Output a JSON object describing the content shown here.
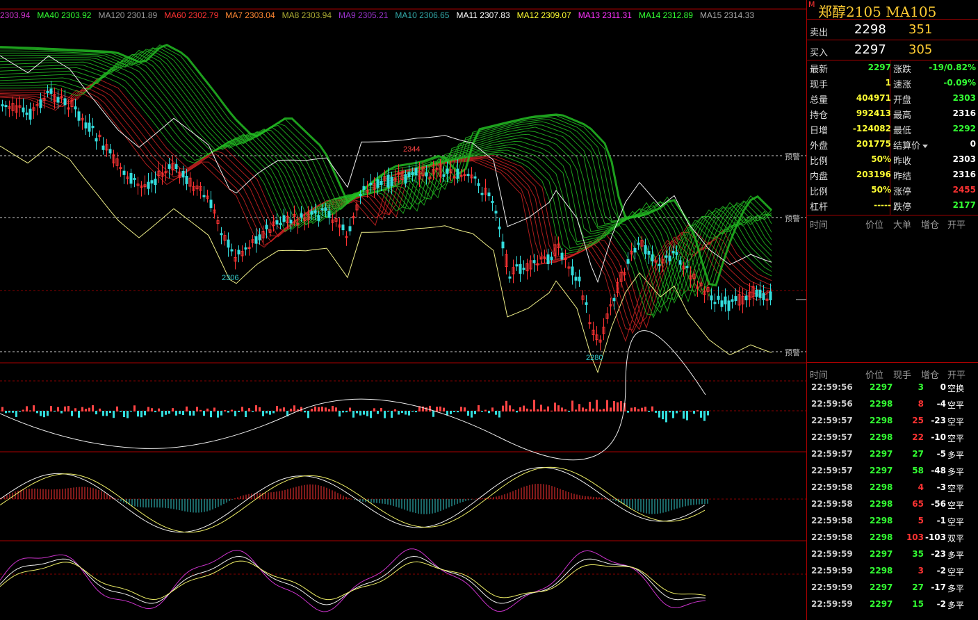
{
  "ma_legend": [
    {
      "text": "2303.94",
      "color": "#cc33cc"
    },
    {
      "text": "MA40 2303.92",
      "color": "#33ff33"
    },
    {
      "text": "MA120 2301.89",
      "color": "#999999"
    },
    {
      "text": "MA60 2302.79",
      "color": "#ff3333"
    },
    {
      "text": "MA7 2303.04",
      "color": "#ff8833"
    },
    {
      "text": "MA8 2303.94",
      "color": "#aaaa33"
    },
    {
      "text": "MA9 2305.21",
      "color": "#9933cc"
    },
    {
      "text": "MA10 2306.65",
      "color": "#33aaaa"
    },
    {
      "text": "MA11 2307.83",
      "color": "#ffffff"
    },
    {
      "text": "MA12 2309.07",
      "color": "#ffff33"
    },
    {
      "text": "MA13 2311.31",
      "color": "#ff33ff"
    },
    {
      "text": "MA14 2312.89",
      "color": "#33ff33"
    },
    {
      "text": "MA15 2314.33",
      "color": "#aaaaaa"
    }
  ],
  "chart": {
    "high_label": "2344",
    "low_label_1": "2306",
    "low_label_2": "2280",
    "warning_label": "预警"
  },
  "panel": {
    "title": "郑醇2105  MA105",
    "corner_mark": "M",
    "sell": {
      "label": "卖出",
      "price": "2298",
      "volume": "351"
    },
    "buy": {
      "label": "买入",
      "price": "2297",
      "volume": "305"
    },
    "quote_rows": [
      {
        "l1": "最新",
        "v1": "2297",
        "c1": "green",
        "l2": "涨跌",
        "v2": "-19/0.82%",
        "c2": "green"
      },
      {
        "l1": "现手",
        "v1": "1",
        "c1": "yellow",
        "l2": "速涨",
        "v2": "-0.09%",
        "c2": "green"
      },
      {
        "l1": "总量",
        "v1": "404971",
        "c1": "yellow",
        "l2": "开盘",
        "v2": "2303",
        "c2": "green"
      },
      {
        "l1": "持仓",
        "v1": "992413",
        "c1": "yellow",
        "l2": "最高",
        "v2": "2316",
        "c2": "white"
      },
      {
        "l1": "日增",
        "v1": "-124082",
        "c1": "yellow",
        "l2": "最低",
        "v2": "2292",
        "c2": "green"
      },
      {
        "l1": "外盘",
        "v1": "201775",
        "c1": "yellow",
        "l2": "结算价",
        "v2": "0",
        "c2": "white"
      },
      {
        "l1": "比例",
        "v1": "50%",
        "c1": "yellow",
        "l2": "昨收",
        "v2": "2303",
        "c2": "white"
      },
      {
        "l1": "内盘",
        "v1": "203196",
        "c1": "yellow",
        "l2": "昨结",
        "v2": "2316",
        "c2": "white"
      },
      {
        "l1": "比例",
        "v1": "50%",
        "c1": "yellow",
        "l2": "涨停",
        "v2": "2455",
        "c2": "red"
      },
      {
        "l1": "杠杆",
        "v1": "-----",
        "c1": "yellow",
        "l2": "跌停",
        "v2": "2177",
        "c2": "green"
      }
    ],
    "big_header": [
      "时间",
      "价位",
      "大单",
      "增仓",
      "开平"
    ],
    "tick_header": [
      "时间",
      "价位",
      "现手",
      "增仓",
      "开平"
    ],
    "ticks": [
      {
        "time": "22:59:56",
        "price": "2297",
        "pc": "green",
        "vol": "3",
        "vc": "green",
        "chg": "0",
        "type": "空换"
      },
      {
        "time": "22:59:56",
        "price": "2298",
        "pc": "green",
        "vol": "8",
        "vc": "red",
        "chg": "-4",
        "type": "空平"
      },
      {
        "time": "22:59:57",
        "price": "2298",
        "pc": "green",
        "vol": "25",
        "vc": "red",
        "chg": "-23",
        "type": "空平"
      },
      {
        "time": "22:59:57",
        "price": "2298",
        "pc": "green",
        "vol": "22",
        "vc": "red",
        "chg": "-10",
        "type": "空平"
      },
      {
        "time": "22:59:57",
        "price": "2297",
        "pc": "green",
        "vol": "27",
        "vc": "green",
        "chg": "-5",
        "type": "多平"
      },
      {
        "time": "22:59:57",
        "price": "2297",
        "pc": "green",
        "vol": "58",
        "vc": "green",
        "chg": "-48",
        "type": "多平"
      },
      {
        "time": "22:59:58",
        "price": "2298",
        "pc": "green",
        "vol": "4",
        "vc": "red",
        "chg": "-3",
        "type": "空平"
      },
      {
        "time": "22:59:58",
        "price": "2298",
        "pc": "green",
        "vol": "65",
        "vc": "red",
        "chg": "-56",
        "type": "空平"
      },
      {
        "time": "22:59:58",
        "price": "2298",
        "pc": "green",
        "vol": "5",
        "vc": "red",
        "chg": "-1",
        "type": "空平"
      },
      {
        "time": "22:59:58",
        "price": "2298",
        "pc": "green",
        "vol": "103",
        "vc": "red",
        "chg": "-103",
        "type": "双平"
      },
      {
        "time": "22:59:59",
        "price": "2297",
        "pc": "green",
        "vol": "35",
        "vc": "green",
        "chg": "-23",
        "type": "多平"
      },
      {
        "time": "22:59:59",
        "price": "2298",
        "pc": "green",
        "vol": "3",
        "vc": "red",
        "chg": "-2",
        "type": "空平"
      },
      {
        "time": "22:59:59",
        "price": "2297",
        "pc": "green",
        "vol": "27",
        "vc": "green",
        "chg": "-17",
        "type": "多平"
      },
      {
        "time": "22:59:59",
        "price": "2297",
        "pc": "green",
        "vol": "15",
        "vc": "green",
        "chg": "-2",
        "type": "多平"
      }
    ]
  }
}
